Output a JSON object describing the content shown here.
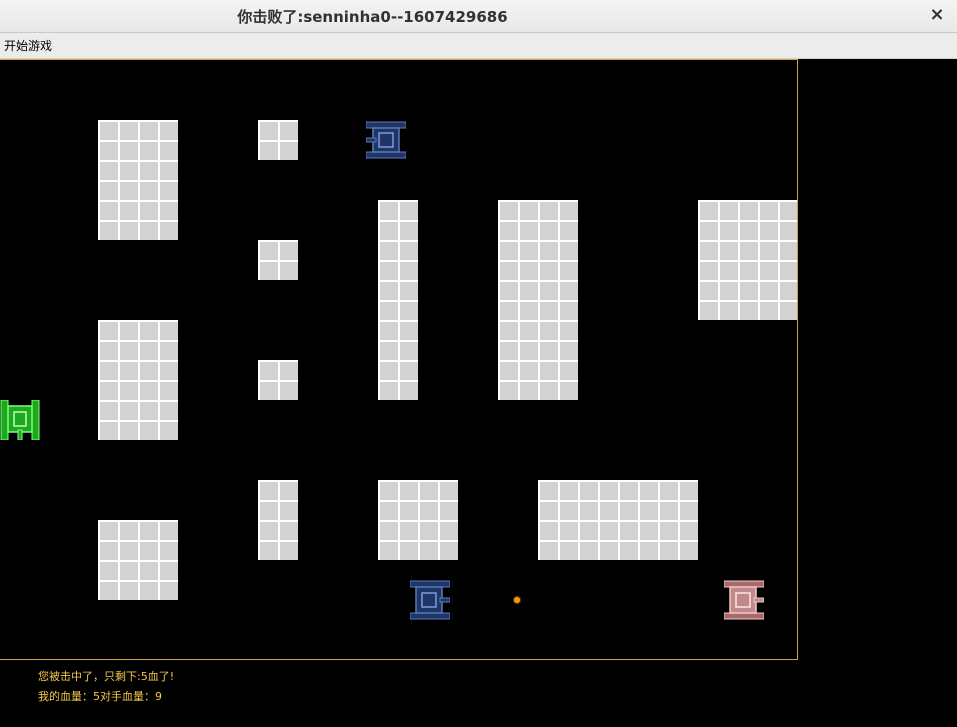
{
  "window": {
    "title": "你击败了:senninha0--1607429686",
    "close_symbol": "×"
  },
  "menu": {
    "start_game": "开始游戏"
  },
  "status": {
    "hit_message": "您被击中了，只剩下:5血了!",
    "health_line": "我的血量：5对手血量：9"
  },
  "colors": {
    "field_border": "#d4a23c",
    "wall": "#d2d2d2",
    "player_tank": "#3ddc3d",
    "enemy_tank": "#1f3566",
    "opponent_tank": "#c08a8a",
    "bullet": "#ff9800",
    "status_text": "#f5c84a"
  },
  "game": {
    "player_tank_color": "green",
    "enemy_tank_color": "navy",
    "opponent_tank_color": "pink"
  }
}
